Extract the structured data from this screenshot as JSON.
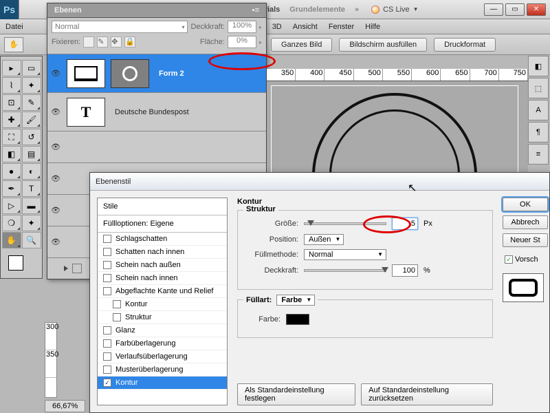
{
  "app_badge": "Ps",
  "top_tabs": {
    "left": "-Tutorials",
    "right": "Grundelemente",
    "more": "»"
  },
  "cs_live": "CS Live",
  "menu": {
    "datei": "Datei",
    "td": "3D",
    "ansicht": "Ansicht",
    "fenster": "Fenster",
    "hilfe": "Hilfe"
  },
  "options": {
    "ganzes": "Ganzes Bild",
    "bildschirm": "Bildschirm ausfüllen",
    "druck": "Druckformat"
  },
  "ebenen": {
    "title": "Ebenen",
    "blend": "Normal",
    "deckkraft_lbl": "Deckkraft:",
    "deckkraft_val": "100%",
    "fixieren_lbl": "Fixieren:",
    "flaeche_lbl": "Fläche:",
    "flaeche_val": "0%",
    "layer1": "Form 2",
    "layer2": "Deutsche Bundespost"
  },
  "ruler_ticks": [
    "350",
    "400",
    "450",
    "500",
    "550",
    "600",
    "650",
    "700",
    "750"
  ],
  "dialog": {
    "title": "Ebenenstil",
    "stile": "Stile",
    "fuell": "Füllloptionen: Eigene",
    "styles": [
      "Schlagschatten",
      "Schatten nach innen",
      "Schein nach außen",
      "Schein nach innen",
      "Abgeflachte Kante und Relief",
      "Kontur",
      "Struktur",
      "Glanz",
      "Farbüberlagerung",
      "Verlaufsüberlagerung",
      "Musterüberlagerung",
      "Kontur"
    ],
    "group_kontur": "Kontur",
    "group_struktur": "Struktur",
    "groesse": "Größe:",
    "groesse_val": "5",
    "px": "Px",
    "position": "Position:",
    "position_val": "Außen",
    "fuellmethode": "Füllmethode:",
    "fuellmethode_val": "Normal",
    "deckkraft2": "Deckkraft:",
    "deckkraft2_val": "100",
    "pct": "%",
    "group_fuellart": "Füllart:",
    "fuellart_val": "Farbe",
    "farbe": "Farbe:",
    "btn_std_set": "Als Standardeinstellung festlegen",
    "btn_std_reset": "Auf Standardeinstellung zurücksetzen",
    "ok": "OK",
    "abbr": "Abbrech",
    "neuer": "Neuer St",
    "vorschau": "Vorsch"
  },
  "zoom": "66,67%",
  "vruler": [
    "300",
    "350"
  ]
}
